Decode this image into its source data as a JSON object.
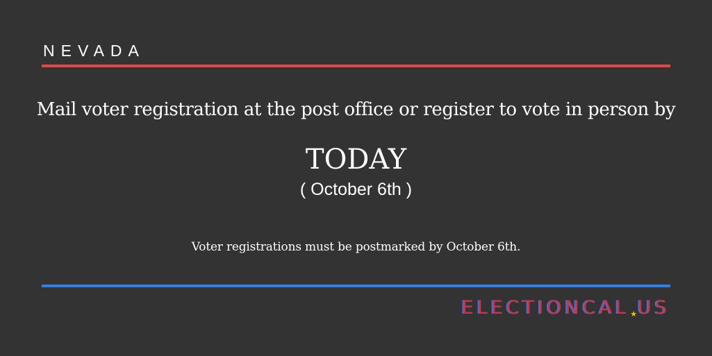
{
  "header": {
    "state": "NEVADA"
  },
  "main": {
    "intro": "Mail voter registration at the post office or register to vote in person by",
    "deadline_label": "TODAY",
    "deadline_date": "( October 6th )",
    "note": "Voter registrations must be postmarked by October 6th."
  },
  "footer": {
    "brand_part1": "ELECTIONCAL",
    "brand_separator_icon": "star-icon",
    "brand_part2": "US"
  },
  "colors": {
    "background": "#333333",
    "top_rule": "#e84545",
    "bottom_rule": "#2f7fe6",
    "brand_text": "#c8344a",
    "brand_shadow": "#4a6fd0",
    "brand_star": "#f2c200"
  }
}
